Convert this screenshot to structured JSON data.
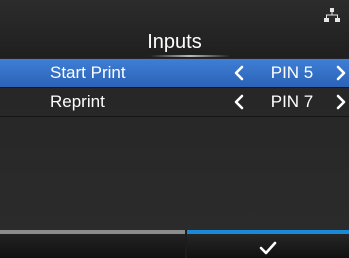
{
  "header": {
    "title": "Inputs",
    "status_icon": "network-icon"
  },
  "rows": [
    {
      "label": "Start Print",
      "value": "PIN 5",
      "selected": true
    },
    {
      "label": "Reprint",
      "value": "PIN 7",
      "selected": false
    }
  ],
  "footer": {
    "left_icon": "",
    "right_icon": "check-icon"
  },
  "colors": {
    "selection": "#2f6fcb",
    "footer_left_bar": "#8d8d8d",
    "footer_right_bar": "#1a8ad8"
  }
}
